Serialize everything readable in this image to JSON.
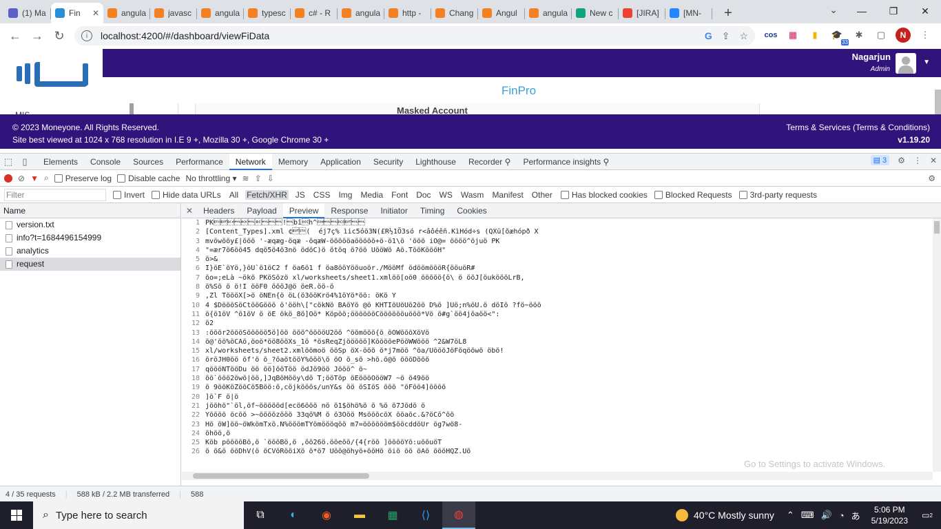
{
  "browser": {
    "tabs": [
      {
        "title": "(1) Ma",
        "color": "#5b5fc7"
      },
      {
        "title": "Fin",
        "color": "#2a8fd6",
        "active": true
      },
      {
        "title": "angula",
        "color": "#f48024"
      },
      {
        "title": "javasc",
        "color": "#f48024"
      },
      {
        "title": "angula",
        "color": "#f48024"
      },
      {
        "title": "typesc",
        "color": "#f48024"
      },
      {
        "title": "c# - R",
        "color": "#f48024"
      },
      {
        "title": "angula",
        "color": "#f48024"
      },
      {
        "title": "http -",
        "color": "#f48024"
      },
      {
        "title": "Chang",
        "color": "#f48024"
      },
      {
        "title": "Angul",
        "color": "#f48024"
      },
      {
        "title": "angula",
        "color": "#f48024"
      },
      {
        "title": "New c",
        "color": "#10a37f"
      },
      {
        "title": "[JIRA]",
        "color": "#ea4335"
      },
      {
        "title": "[MN-",
        "color": "#2684ff"
      }
    ],
    "url": "localhost:4200/#/dashboard/viewFiData",
    "profile_initial": "N",
    "ext_badge": "33"
  },
  "app": {
    "user_name": "Nagarjun",
    "user_role": "Admin",
    "title": "FinPro",
    "sidebar_peek": "MIS",
    "content_peek": "Masked Account",
    "footer_copyright": "© 2023 Moneyone. All Rights Reserved.",
    "footer_browsers": "Site best viewed at 1024 x 768 resolution in I.E 9 +, Mozilla 30 +, Google Chrome 30 +",
    "footer_terms": "Terms & Services (Terms & Conditions)",
    "footer_version": "v1.19.20"
  },
  "devtools": {
    "tabs": [
      "Elements",
      "Console",
      "Sources",
      "Performance",
      "Network",
      "Memory",
      "Application",
      "Security",
      "Lighthouse",
      "Recorder ⚲",
      "Performance insights ⚲"
    ],
    "active_tab": "Network",
    "issues_count": "3",
    "toolbar": {
      "preserve_log": "Preserve log",
      "disable_cache": "Disable cache",
      "throttling": "No throttling"
    },
    "filter": {
      "placeholder": "Filter",
      "invert": "Invert",
      "hide_data_urls": "Hide data URLs",
      "types": [
        "All",
        "Fetch/XHR",
        "JS",
        "CSS",
        "Img",
        "Media",
        "Font",
        "Doc",
        "WS",
        "Wasm",
        "Manifest",
        "Other"
      ],
      "active_type": "Fetch/XHR",
      "blocked_cookies": "Has blocked cookies",
      "blocked_requests": "Blocked Requests",
      "third_party": "3rd-party requests"
    },
    "requests_header": "Name",
    "requests": [
      "version.txt",
      "info?t=1684496154999",
      "analytics",
      "request"
    ],
    "selected_request": "request",
    "detail_tabs": [
      "Headers",
      "Payload",
      "Preview",
      "Response",
      "Initiator",
      "Timing",
      "Cookies"
    ],
    "active_detail_tab": "Preview",
    "preview_lines": [
      "PK\u0003\u0004\u0014\u0000\u0006\u0000\b\u0000\u0000\u0000!\u0000bîh^\u0001\u0000\u0000\u0004\u0000\u0000",
      "[Content_Types].xml ¢\u0004\u0002(  éj7ç% ìic5óö3N(£R½1Ö3só r<âôéêñ.KìHód÷s (QXü[õæhópð X",
      "mvöwööy£|ööö '-æqæg-öqæ -öqæW-öööööaööööö+ö-ö1\\ö 'ööö iO@= öööö^öjuö PK",
      "\"=ær7ö6öö45 dqö5ö4ö3nö ödöC)ö ötöq ö?öö UööWö Aö.TööKöööH\"",
      "ö>&",
      "I}öE`öYö,}öU`ö1öC2 f öa6ö1 f öa8ööYööuoör./MööMf ödöömöööR{ööuöR#",
      "öo=;eLà ~ökö PKöSözö xl/worksheets/sheet1.xmlöö[oö0 ööööö{ö\\ ö ööJ[öuköööLrB,",
      "ö%Sö  ö ö!I ööF0 öööJ@ö öeR.öö-ö",
      ",Zl TöööX[>ö öNEn{ö öL(ö3ööKrö4%1öYö*öö:  öKö Y",
      "4 $DöööSöCtööGööö ö'ööh\\[\"cökNö BAöYö @ö KHTIöUöUö2öö D%ö ]Uö;n%öU.ö döIö ?fö~ööö",
      "ö{ö1öV ^ö1öV ö öE ökö_8ö]Oö* Köpöö;ööööööCööööööuööö*Vö ö#g`öö4jöaöö<\":",
      "ö2",
      ":ööör2öööSööööö5ö]öö ööö^ööööU2öö ^öömööö{ö öOWöööXöVö",
      "ö@'öö%öCAö,öoö*öö8ööXs_1ö *ösReqZjööööö]KööööePööWWööö ^2&W7öL8",
      "xl/worksheets/sheet2.xmlöömoö ööSp öX-ööö ö*j7möö  ^öa/UöööJöFöqööwö öbö!",
      "öröJH0öö öf'ö ö_?öaötööY%ööö\\ö öO ö_sö >hö.ö@ö öööDööö",
      "qöööNTööDu  öö öö]ööTöö ödJö9öö Jööö^ ö~",
      "öö`ööö2öwö|öö,]JqBöHööy\\dö T;ööTöp öEöööOööW7 ~ö ö49öö",
      "ö 9ööKöZööCö5Böö:ö,cöjkööös/unY&s öö öSIöS ööö \"öFöö4]öööö",
      "]ö`F ö|ö",
      "jööhö\"`öl,öf~öööööd[ecö6ööö nö ö1$öhö%ö ö %ö ö7Jödö ö",
      "Yöööö öcöö >~öööözööö 33qö%M ö ö3Oöö MsöööcöX ööaöc.&?öCö^öö",
      "Hö öW]öö~öWkömTxö.N%ööömTYömöööqöö m7=ööööööm$ööcddöUr ög7wö8-",
      "öhöö,ö",
      "Köb    pööööBö,ö `öööBö,ö ,öö26ö.ööeöö/{4{röö ]ööööYö:uööuöT",
      "ö ö&ö ööDhV(ö öCVöRööiXö ö*ö7 Uöö@öhyö+ööHö öiö öö öAö öööHQZ.Uö"
    ],
    "status_requests": "4 / 35 requests",
    "status_transferred": "588 kB / 2.2 MB transferred",
    "status_more": "588"
  },
  "watermark": "Go to Settings to activate Windows.",
  "taskbar": {
    "search_placeholder": "Type here to search",
    "weather": "40°C  Mostly sunny",
    "time": "5:06 PM",
    "date": "5/19/2023",
    "notifications": "2"
  }
}
